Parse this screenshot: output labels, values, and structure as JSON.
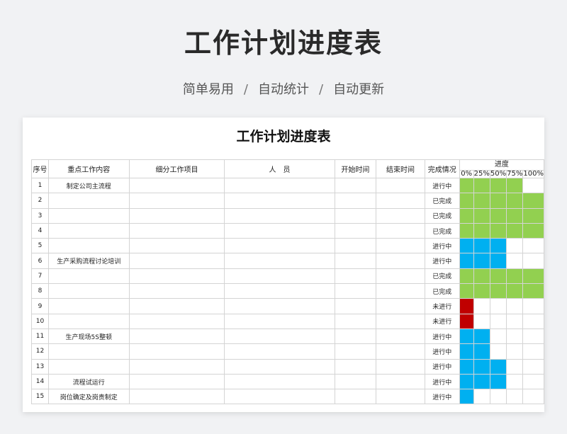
{
  "page": {
    "title": "工作计划进度表",
    "subtitle_parts": [
      "简单易用",
      "自动统计",
      "自动更新"
    ],
    "separator": "/"
  },
  "sheet": {
    "title": "工作计划进度表",
    "headers": {
      "index": "序号",
      "key_work": "重点工作内容",
      "sub_items": "细分工作项目",
      "people": "人　员",
      "start_time": "开始时间",
      "end_time": "结束时间",
      "status": "完成情况",
      "progress": "进度"
    },
    "progress_ticks": [
      "0%",
      "25%",
      "50%",
      "75%",
      "100%"
    ],
    "colors": {
      "done": "#92d050",
      "in_progress_blue": "#00b0f0",
      "not_started": "#c00000"
    },
    "rows": [
      {
        "index": "1",
        "key_work": "制定公司主流程",
        "status": "进行中",
        "progress": 0.8,
        "color": "green"
      },
      {
        "index": "2",
        "key_work": "",
        "status": "已完成",
        "progress": 1.0,
        "color": "green"
      },
      {
        "index": "3",
        "key_work": "",
        "status": "已完成",
        "progress": 1.0,
        "color": "green"
      },
      {
        "index": "4",
        "key_work": "",
        "status": "已完成",
        "progress": 1.0,
        "color": "green"
      },
      {
        "index": "5",
        "key_work": "",
        "status": "进行中",
        "progress": 0.6,
        "color": "blue"
      },
      {
        "index": "6",
        "key_work": "生产采购流程讨论培训",
        "status": "进行中",
        "progress": 0.6,
        "color": "blue"
      },
      {
        "index": "7",
        "key_work": "",
        "status": "已完成",
        "progress": 1.0,
        "color": "green"
      },
      {
        "index": "8",
        "key_work": "",
        "status": "已完成",
        "progress": 1.0,
        "color": "green"
      },
      {
        "index": "9",
        "key_work": "",
        "status": "未进行",
        "progress": 0.2,
        "color": "red"
      },
      {
        "index": "10",
        "key_work": "",
        "status": "未进行",
        "progress": 0.2,
        "color": "red"
      },
      {
        "index": "11",
        "key_work": "生产现场5S整顿",
        "status": "进行中",
        "progress": 0.4,
        "color": "blue"
      },
      {
        "index": "12",
        "key_work": "",
        "status": "进行中",
        "progress": 0.4,
        "color": "blue"
      },
      {
        "index": "13",
        "key_work": "",
        "status": "进行中",
        "progress": 0.6,
        "color": "blue"
      },
      {
        "index": "14",
        "key_work": "流程试运行",
        "status": "进行中",
        "progress": 0.6,
        "color": "blue"
      },
      {
        "index": "15",
        "key_work": "岗位确定及岗责制定",
        "status": "进行中",
        "progress": 0.2,
        "color": "blue"
      }
    ]
  }
}
